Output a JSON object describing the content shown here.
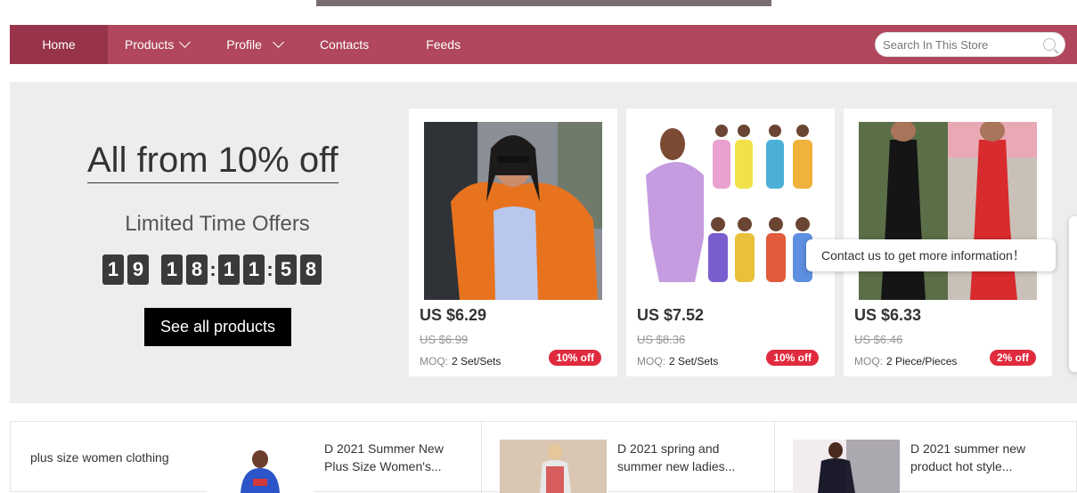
{
  "nav": {
    "items": [
      {
        "label": "Home"
      },
      {
        "label": "Products"
      },
      {
        "label": "Profile"
      },
      {
        "label": "Contacts"
      },
      {
        "label": "Feeds"
      }
    ],
    "search_placeholder": "Search In This Store"
  },
  "promo": {
    "title": "All from 10% off",
    "subtitle": "Limited Time Offers",
    "countdown": {
      "days": [
        "1",
        "9"
      ],
      "hours": [
        "1",
        "8"
      ],
      "minutes": [
        "1",
        "1"
      ],
      "seconds": [
        "5",
        "8"
      ],
      "sep": ":"
    },
    "cta": "See all products"
  },
  "products": [
    {
      "price": "US $6.29",
      "old_price": "US $6.99",
      "moq_label": "MOQ:",
      "moq": "2 Set/Sets",
      "badge": "10% off"
    },
    {
      "price": "US $7.52",
      "old_price": "US $8.36",
      "moq_label": "MOQ:",
      "moq": "2 Set/Sets",
      "badge": "10% off"
    },
    {
      "price": "US $6.33",
      "old_price": "US $6.46",
      "moq_label": "MOQ:",
      "moq": "2 Piece/Pieces",
      "badge": "2% off"
    }
  ],
  "tooltip": "Contact us to get more information！",
  "bottom": {
    "category": "plus size women clothing",
    "items": [
      {
        "title_line1": "D 2021 Summer New",
        "title_line2": "Plus Size Women's..."
      },
      {
        "title_line1": "D 2021 spring and",
        "title_line2": "summer new ladies..."
      },
      {
        "title_line1": "D 2021 summer new",
        "title_line2": "product hot style..."
      }
    ]
  },
  "colors": {
    "nav": "#b0475c",
    "nav_active": "#97344a",
    "badge": "#e02b3e"
  }
}
